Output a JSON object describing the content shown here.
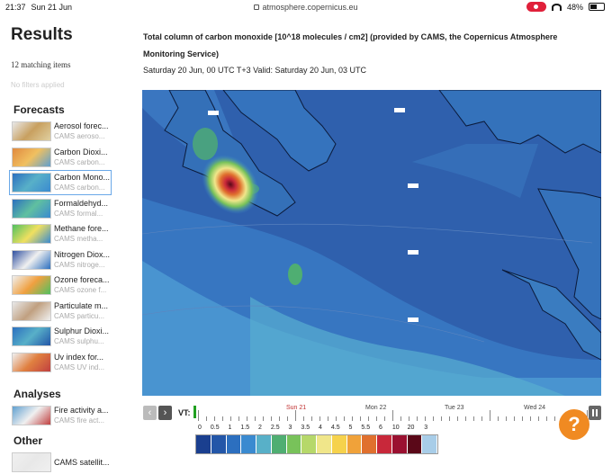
{
  "status_bar": {
    "time": "21:37",
    "date": "Sun 21 Jun",
    "url": "atmosphere.copernicus.eu",
    "battery": "48%"
  },
  "sidebar": {
    "title": "Results",
    "matching": "12 matching items",
    "filters": "No filters applied",
    "sections": [
      {
        "name": "Forecasts",
        "items": [
          {
            "name": "Aerosol forec...",
            "sub": "CAMS aeroso...",
            "thumb": "aerosol"
          },
          {
            "name": "Carbon Dioxi...",
            "sub": "CAMS carbon...",
            "thumb": "co2"
          },
          {
            "name": "Carbon Mono...",
            "sub": "CAMS carbon...",
            "thumb": "co",
            "selected": true
          },
          {
            "name": "Formaldehyd...",
            "sub": "CAMS formal...",
            "thumb": "hcho"
          },
          {
            "name": "Methane fore...",
            "sub": "CAMS metha...",
            "thumb": "ch4"
          },
          {
            "name": "Nitrogen Diox...",
            "sub": "CAMS nitroge...",
            "thumb": "no2"
          },
          {
            "name": "Ozone foreca...",
            "sub": "CAMS ozone f...",
            "thumb": "o3"
          },
          {
            "name": "Particulate m...",
            "sub": "CAMS particu...",
            "thumb": "pm"
          },
          {
            "name": "Sulphur Dioxi...",
            "sub": "CAMS sulphu...",
            "thumb": "so2"
          },
          {
            "name": "Uv index for...",
            "sub": "CAMS UV ind...",
            "thumb": "uv"
          }
        ]
      },
      {
        "name": "Analyses",
        "items": [
          {
            "name": "Fire activity a...",
            "sub": "CAMS fire act...",
            "thumb": "fire"
          }
        ]
      },
      {
        "name": "Other",
        "items": [
          {
            "name": "CAMS satellit...",
            "sub": "",
            "thumb": "sat"
          }
        ]
      }
    ]
  },
  "main": {
    "title": "Total column of carbon monoxide [10^18 molecules / cm2] (provided by CAMS, the Copernicus Atmosphere Monitoring Service)",
    "subtitle": "Saturday 20 Jun, 00 UTC T+3 Valid: Saturday 20 Jun, 03 UTC"
  },
  "timeline": {
    "vt_label": "VT:",
    "days": [
      "Sun 21",
      "Mon 22",
      "Tue 23",
      "Wed 24"
    ],
    "current_day": "Sun 21"
  },
  "legend": {
    "labels": [
      "0",
      "0.5",
      "1",
      "1.5",
      "2",
      "2.5",
      "3",
      "3.5",
      "4",
      "4.5",
      "5",
      "5.5",
      "6",
      "10",
      "20",
      "3"
    ],
    "colors": [
      "#1a3f8f",
      "#2356a8",
      "#2c6fbf",
      "#3a8ad0",
      "#58b0c8",
      "#4fae72",
      "#78c25a",
      "#b6d86a",
      "#f0e68a",
      "#f6d24c",
      "#f0a23a",
      "#e0702e",
      "#c8283a",
      "#9a1030",
      "#5a0818",
      "#a8cde8"
    ]
  },
  "help_button": "?"
}
